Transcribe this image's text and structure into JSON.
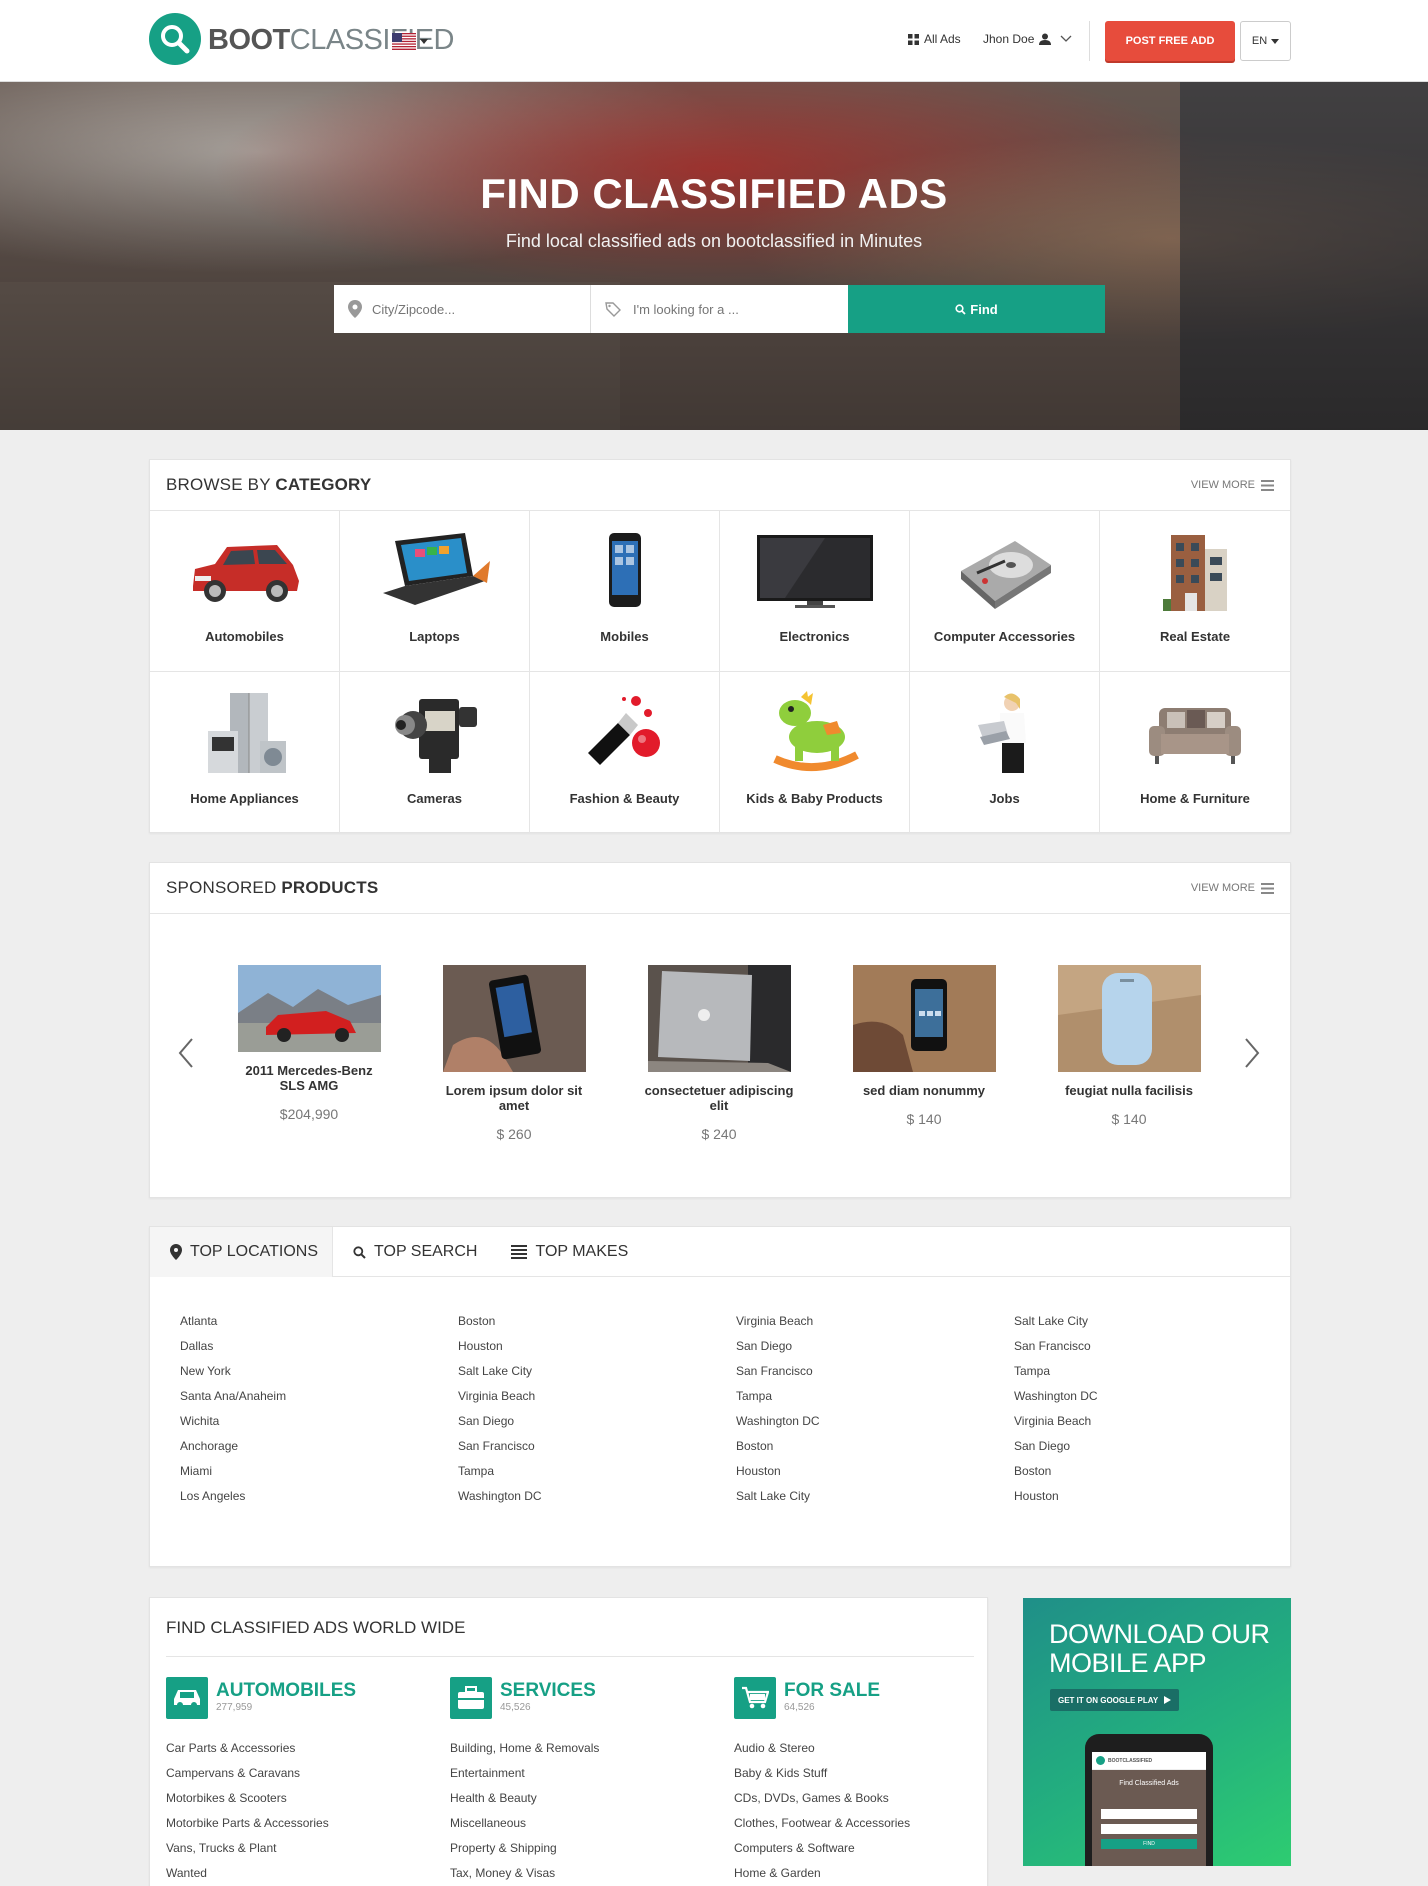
{
  "header": {
    "logo_bold": "BOOT",
    "logo_light": "CLASSIFIED",
    "all_ads": "All Ads",
    "user_name": "Jhon Doe",
    "post_button": "POST FREE ADD",
    "language": "EN"
  },
  "hero": {
    "title": "FIND CLASSIFIED ADS",
    "subtitle": "Find local classified ads on bootclassified in Minutes",
    "location_placeholder": "City/Zipcode...",
    "query_placeholder": "I'm looking for a ...",
    "find_button": "Find"
  },
  "categories": {
    "title_light": "BROWSE BY ",
    "title_bold": "CATEGORY",
    "view_more": "VIEW MORE",
    "items": [
      {
        "label": "Automobiles",
        "icon": "car-icon"
      },
      {
        "label": "Laptops",
        "icon": "laptop-icon"
      },
      {
        "label": "Mobiles",
        "icon": "smartphone-icon"
      },
      {
        "label": "Electronics",
        "icon": "tv-icon"
      },
      {
        "label": "Computer Accessories",
        "icon": "hard-drive-icon"
      },
      {
        "label": "Real Estate",
        "icon": "building-icon"
      },
      {
        "label": "Home Appliances",
        "icon": "refrigerator-icon"
      },
      {
        "label": "Cameras",
        "icon": "camera-icon"
      },
      {
        "label": "Fashion & Beauty",
        "icon": "nail-polish-icon"
      },
      {
        "label": "Kids & Baby Products",
        "icon": "rocking-horse-icon"
      },
      {
        "label": "Jobs",
        "icon": "businesswoman-icon"
      },
      {
        "label": "Home & Furniture",
        "icon": "sofa-icon"
      }
    ]
  },
  "sponsored": {
    "title_light": "SPONSORED ",
    "title_bold": "PRODUCTS",
    "view_more": "VIEW MORE",
    "products": [
      {
        "title": "2011 Mercedes-Benz SLS AMG",
        "price": "$204,990"
      },
      {
        "title": "Lorem ipsum dolor sit amet",
        "price": "$ 260"
      },
      {
        "title": "consectetuer adipiscing elit",
        "price": "$ 240"
      },
      {
        "title": "sed diam nonummy",
        "price": "$ 140"
      },
      {
        "title": "feugiat nulla facilisis",
        "price": "$ 140"
      }
    ]
  },
  "tabs": {
    "items": [
      "TOP LOCATIONS",
      "TOP SEARCH",
      "TOP MAKES"
    ],
    "columns": [
      [
        "Atlanta",
        "Dallas",
        "New York",
        "Santa Ana/Anaheim",
        "Wichita",
        "Anchorage",
        "Miami",
        "Los Angeles"
      ],
      [
        "Boston",
        "Houston",
        "Salt Lake City",
        "Virginia Beach",
        "San Diego",
        "San Francisco",
        "Tampa",
        "Washington DC"
      ],
      [
        "Virginia Beach",
        "San Diego",
        "San Francisco",
        "Tampa",
        "Washington DC",
        "Boston",
        "Houston",
        "Salt Lake City"
      ],
      [
        "Salt Lake City",
        "San Francisco",
        "Tampa",
        "Washington DC",
        "Virginia Beach",
        "San Diego",
        "Boston",
        "Houston"
      ]
    ]
  },
  "worldwide": {
    "title": "FIND CLASSIFIED ADS WORLD WIDE",
    "groups": [
      {
        "name": "AUTOMOBILES",
        "count": "277,959",
        "icon": "car-icon",
        "items": [
          "Car Parts & Accessories",
          "Campervans & Caravans",
          "Motorbikes & Scooters",
          "Motorbike Parts & Accessories",
          "Vans, Trucks & Plant",
          "Wanted"
        ]
      },
      {
        "name": "SERVICES",
        "count": "45,526",
        "icon": "briefcase-icon",
        "items": [
          "Building, Home & Removals",
          "Entertainment",
          "Health & Beauty",
          "Miscellaneous",
          "Property & Shipping",
          "Tax, Money & Visas"
        ]
      },
      {
        "name": "FOR SALE",
        "count": "64,526",
        "icon": "shopping-cart-icon",
        "items": [
          "Audio & Stereo",
          "Baby & Kids Stuff",
          "CDs, DVDs, Games & Books",
          "Clothes, Footwear & Accessories",
          "Computers & Software",
          "Home & Garden"
        ]
      }
    ]
  },
  "app_promo": {
    "title_line1": "DOWNLOAD OUR",
    "title_line2": "MOBILE APP",
    "google_play": "GET IT ON GOOGLE PLAY",
    "phone_logo": "BOOTCLASSIFIED",
    "phone_heading": "Find Classified Ads",
    "phone_button": "FIND"
  },
  "colors": {
    "accent": "#16a085",
    "danger": "#e74c3c"
  }
}
